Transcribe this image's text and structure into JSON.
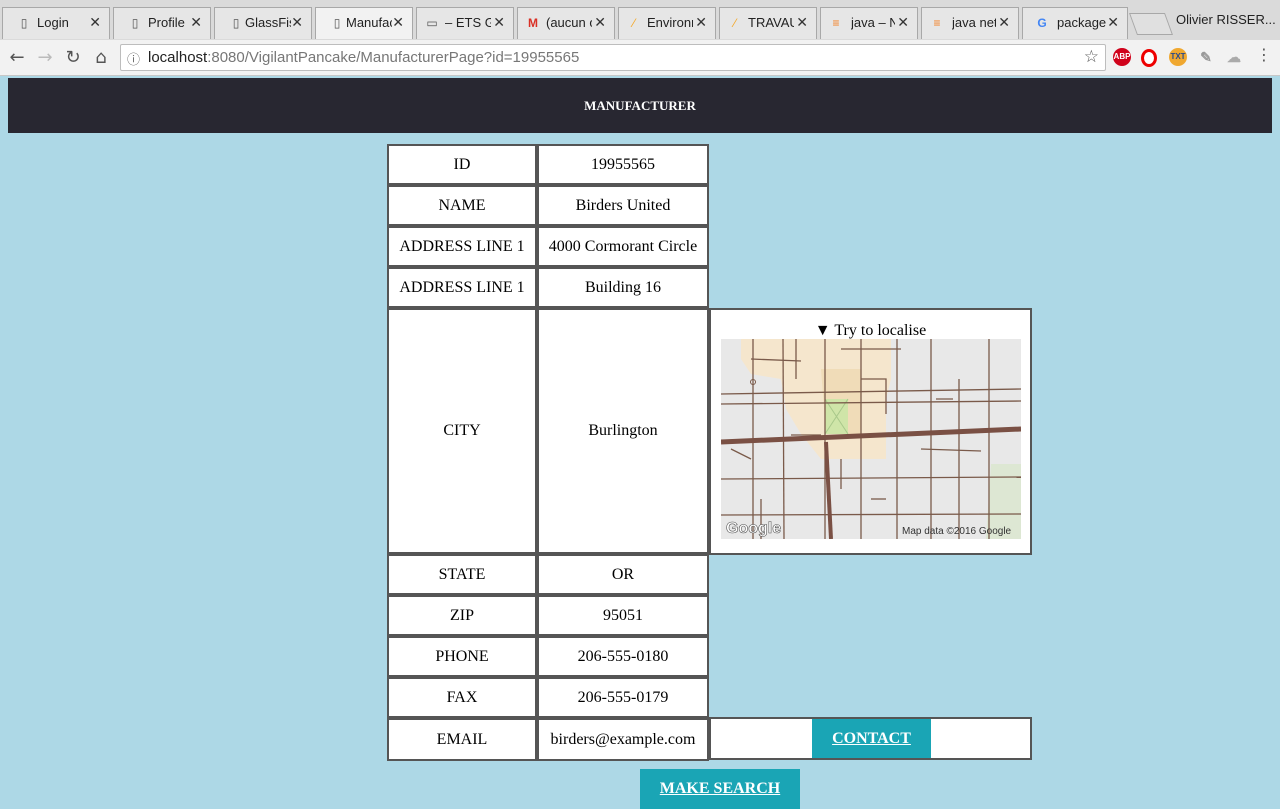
{
  "browser": {
    "tabs": [
      {
        "icon": "page-icon",
        "title": "Login"
      },
      {
        "icon": "page-icon",
        "title": "Profile"
      },
      {
        "icon": "page-icon",
        "title": "GlassFish"
      },
      {
        "icon": "page-icon",
        "title": "Manufac"
      },
      {
        "icon": "ets-icon",
        "title": "– ETS GL"
      },
      {
        "icon": "gmail-icon",
        "title": "(aucun o"
      },
      {
        "icon": "pencil-icon",
        "title": "Environn"
      },
      {
        "icon": "pencil-icon",
        "title": "TRAVAUX"
      },
      {
        "icon": "stackoverflow-icon",
        "title": "java – N"
      },
      {
        "icon": "stackoverflow-icon",
        "title": "java neth"
      },
      {
        "icon": "google-icon",
        "title": "package"
      }
    ],
    "active_tab_index": 3,
    "profile_name": "Olivier RISSER...",
    "url_host": "localhost",
    "url_rest": ":8080/VigilantPancake/ManufacturerPage?id=19955565"
  },
  "page": {
    "header_title": "MANUFACTURER",
    "rows": [
      {
        "label": "ID",
        "value": "19955565"
      },
      {
        "label": "NAME",
        "value": "Birders United"
      },
      {
        "label": "ADDRESS LINE 1",
        "value": "4000 Cormorant Circle"
      },
      {
        "label": "ADDRESS LINE 1",
        "value": "Building 16"
      },
      {
        "label": "CITY",
        "value": "Burlington"
      },
      {
        "label": "STATE",
        "value": "OR"
      },
      {
        "label": "ZIP",
        "value": "95051"
      },
      {
        "label": "PHONE",
        "value": "206-555-0180"
      },
      {
        "label": "FAX",
        "value": "206-555-0179"
      },
      {
        "label": "EMAIL",
        "value": "birders@example.com"
      }
    ],
    "map": {
      "toggle_label": "▼ Try to localise",
      "logo": "Google",
      "attribution": "Map data ©2016 Google"
    },
    "contact_label": "CONTACT",
    "search_label": "MAKE SEARCH"
  },
  "colors": {
    "page_bg": "#add8e6",
    "header_bg": "#282731",
    "button_bg": "#1aa5b5"
  }
}
